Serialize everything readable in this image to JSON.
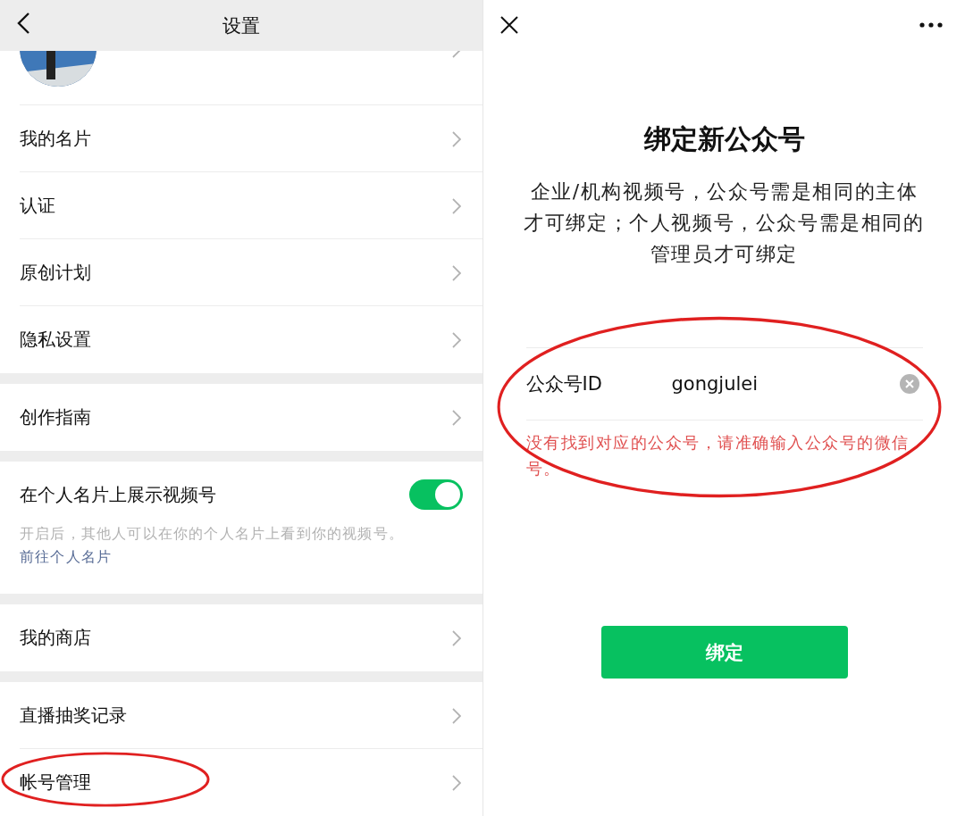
{
  "settings_screen": {
    "title": "设置",
    "groups": [
      {
        "items": [
          {
            "kind": "profile"
          },
          {
            "kind": "link",
            "label": "我的名片",
            "circled": false
          },
          {
            "kind": "link",
            "label": "认证",
            "circled": false
          },
          {
            "kind": "link",
            "label": "原创计划",
            "circled": false
          },
          {
            "kind": "link",
            "label": "隐私设置",
            "circled": false
          }
        ]
      },
      {
        "items": [
          {
            "kind": "link",
            "label": "创作指南",
            "circled": false
          }
        ]
      },
      {
        "items": [
          {
            "kind": "toggle",
            "label": "在个人名片上展示视频号",
            "on": true,
            "description": "开启后，其他人可以在你的个人名片上看到你的视频号。",
            "link": "前往个人名片"
          }
        ]
      },
      {
        "items": [
          {
            "kind": "link",
            "label": "我的商店",
            "circled": false
          }
        ]
      },
      {
        "items": [
          {
            "kind": "link",
            "label": "直播抽奖记录",
            "circled": false
          },
          {
            "kind": "link",
            "label": "帐号管理",
            "circled": true
          }
        ]
      }
    ]
  },
  "bind_screen": {
    "title": "绑定新公众号",
    "description": "企业/机构视频号，公众号需是相同的主体才可绑定；个人视频号，公众号需是相同的管理员才可绑定",
    "field": {
      "label": "公众号ID",
      "value": "gongjulei"
    },
    "error": "没有找到对应的公众号，请准确输入公众号的微信号。",
    "circled": true,
    "button": "绑定"
  }
}
